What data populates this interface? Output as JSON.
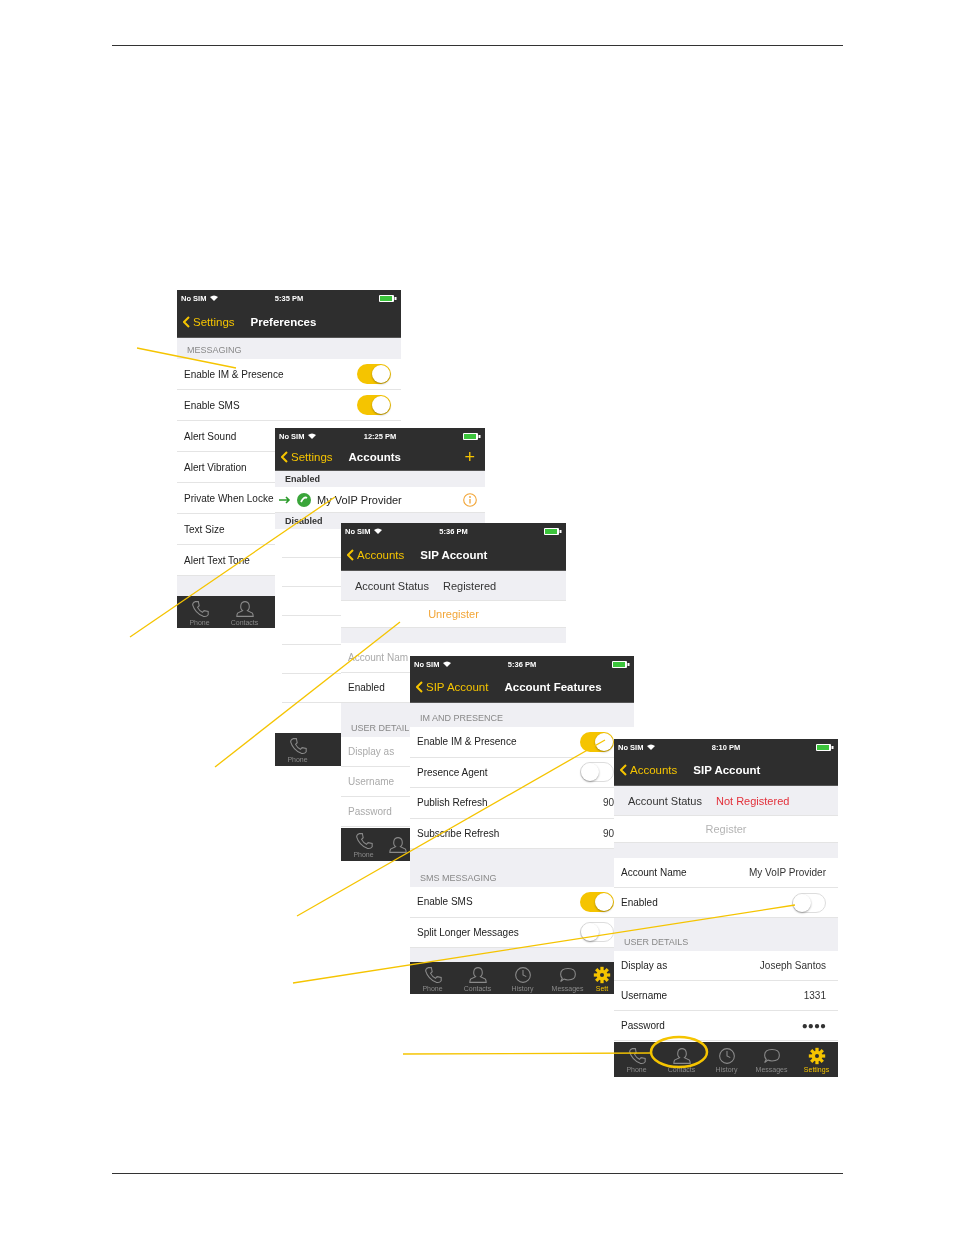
{
  "screens": [
    {
      "status": {
        "carrier": "No SIM",
        "time": "5:35 PM"
      },
      "nav": {
        "back": "Settings",
        "title": "Preferences"
      },
      "items": [
        {
          "kind": "header",
          "label": "MESSAGING"
        },
        {
          "kind": "toggle",
          "label": "Enable IM & Presence",
          "on": true
        },
        {
          "kind": "toggle",
          "label": "Enable SMS",
          "on": true
        },
        {
          "kind": "plain",
          "label": "Alert Sound",
          "disabled": false
        },
        {
          "kind": "plain",
          "label": "Alert Vibration",
          "disabled": false
        },
        {
          "kind": "plain",
          "label": "Private When Locke",
          "disabled": false
        },
        {
          "kind": "plain",
          "label": "Text Size",
          "disabled": false
        },
        {
          "kind": "plain",
          "label": "Alert Text Tone",
          "disabled": false
        },
        {
          "kind": "gap"
        }
      ],
      "tabs": [
        {
          "label": "Phone",
          "selected": false
        },
        {
          "label": "Contacts",
          "selected": false
        }
      ]
    },
    {
      "status": {
        "carrier": "No SIM",
        "time": "12:25 PM"
      },
      "nav": {
        "back": "Settings",
        "title": "Accounts",
        "action": "+"
      },
      "items": [
        {
          "kind": "group",
          "label": "Enabled"
        },
        {
          "kind": "account",
          "label": "My VoIP Provider"
        },
        {
          "kind": "group",
          "label": "Disabled"
        },
        {
          "kind": "blank"
        },
        {
          "kind": "blank"
        },
        {
          "kind": "blank"
        },
        {
          "kind": "blank"
        },
        {
          "kind": "blank"
        },
        {
          "kind": "blank"
        }
      ],
      "tabs": [
        {
          "label": "Phone",
          "selected": false
        }
      ]
    },
    {
      "status": {
        "carrier": "No SIM",
        "time": "5:36 PM"
      },
      "nav": {
        "back": "Accounts",
        "title": "SIP Account"
      },
      "items": [
        {
          "kind": "status",
          "label": "Account Status",
          "value": "Registered",
          "registered": true
        },
        {
          "kind": "action",
          "label": "Unregister",
          "disabled": false
        },
        {
          "kind": "gap"
        },
        {
          "kind": "plain",
          "label": "Account Nam",
          "disabled": true
        },
        {
          "kind": "plain",
          "label": "Enabled",
          "disabled": false
        },
        {
          "kind": "header",
          "label": "USER DETAIL"
        },
        {
          "kind": "plain",
          "label": "Display as",
          "disabled": true
        },
        {
          "kind": "plain",
          "label": "Username",
          "disabled": true
        },
        {
          "kind": "plain",
          "label": "Password",
          "disabled": true
        }
      ],
      "tabs": [
        {
          "label": "Phone",
          "selected": false
        },
        {
          "selected": false
        }
      ]
    },
    {
      "status": {
        "carrier": "No SIM",
        "time": "5:36 PM"
      },
      "nav": {
        "back": "SIP Account",
        "title": "Account Features"
      },
      "items": [
        {
          "kind": "header",
          "label": "IM AND PRESENCE"
        },
        {
          "kind": "toggle",
          "label": "Enable IM & Presence",
          "on": true
        },
        {
          "kind": "toggle",
          "label": "Presence Agent",
          "on": false
        },
        {
          "kind": "value",
          "label": "Publish Refresh",
          "value": "90",
          "disabled": false
        },
        {
          "kind": "value",
          "label": "Subscribe Refresh",
          "value": "90",
          "disabled": false
        },
        {
          "kind": "gap"
        },
        {
          "kind": "header",
          "label": "SMS MESSAGING"
        },
        {
          "kind": "toggle",
          "label": "Enable SMS",
          "on": true
        },
        {
          "kind": "toggle",
          "label": "Split Longer Messages",
          "on": false
        },
        {
          "kind": "gap"
        }
      ],
      "tabs": [
        {
          "label": "Phone",
          "selected": false
        },
        {
          "label": "Contacts",
          "selected": false
        },
        {
          "label": "History",
          "selected": false
        },
        {
          "label": "Messages",
          "selected": false
        },
        {
          "label": "Sett",
          "selected": true
        }
      ]
    },
    {
      "status": {
        "carrier": "No SIM",
        "time": "8:10 PM"
      },
      "nav": {
        "back": "Accounts",
        "title": "SIP Account"
      },
      "items": [
        {
          "kind": "status",
          "label": "Account Status",
          "value": "Not Registered",
          "registered": false
        },
        {
          "kind": "action",
          "label": "Register",
          "disabled": true
        },
        {
          "kind": "gap"
        },
        {
          "kind": "value",
          "label": "Account Name",
          "value": "My VoIP Provider",
          "disabled": false
        },
        {
          "kind": "toggle",
          "label": "Enabled",
          "on": false
        },
        {
          "kind": "header",
          "label": "USER DETAILS"
        },
        {
          "kind": "value",
          "label": "Display as",
          "value": "Joseph Santos",
          "disabled": false
        },
        {
          "kind": "value",
          "label": "Username",
          "value": "1331",
          "disabled": false
        },
        {
          "kind": "value",
          "label": "Password",
          "value": "●●●●",
          "disabled": false
        }
      ],
      "tabs": [
        {
          "label": "Phone",
          "selected": false
        },
        {
          "label": "Contacts",
          "selected": false
        },
        {
          "label": "History",
          "selected": false
        },
        {
          "label": "Messages",
          "selected": false
        },
        {
          "label": "Settings",
          "selected": true
        }
      ]
    }
  ]
}
